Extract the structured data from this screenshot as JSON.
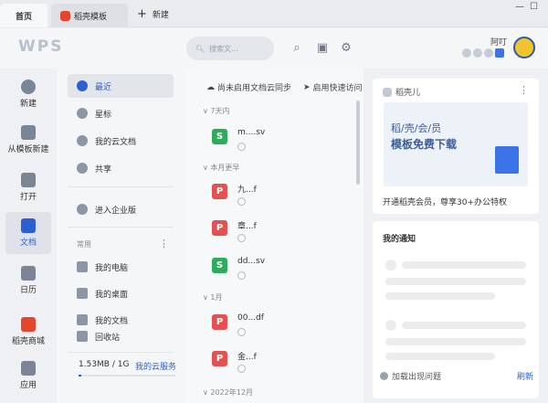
{
  "tabs": [
    {
      "label": "首页"
    },
    {
      "label": "稻壳模板"
    }
  ],
  "new_tab_label": "新建",
  "window_controls": {
    "minimize": "—",
    "maximize": "☐"
  },
  "header": {
    "logo": "WPS",
    "search_placeholder": "搜索文...",
    "username": "阿叮",
    "icons": [
      "headset-icon",
      "shirt-icon",
      "gear-icon"
    ]
  },
  "leftnav": [
    {
      "label": "新建",
      "icon": "plus-icon"
    },
    {
      "label": "从模板新建",
      "icon": "template-icon"
    },
    {
      "label": "打开",
      "icon": "folder-icon"
    },
    {
      "label": "文档",
      "icon": "document-icon",
      "active": true
    },
    {
      "label": "日历",
      "icon": "calendar-icon"
    },
    {
      "label": "稻壳商城",
      "icon": "store-icon"
    },
    {
      "label": "应用",
      "icon": "apps-icon"
    }
  ],
  "sidebar": {
    "items": [
      {
        "label": "最近",
        "active": true
      },
      {
        "label": "星标"
      },
      {
        "label": "我的云文档"
      },
      {
        "label": "共享"
      },
      {
        "label": "进入企业版"
      }
    ],
    "common_label": "常用",
    "common_items": [
      {
        "label": "我的电脑"
      },
      {
        "label": "我的桌面"
      },
      {
        "label": "我的文档"
      },
      {
        "label": "回收站"
      }
    ],
    "storage": "1.53MB / 1G",
    "storage_link": "我的云服务",
    "storage_fraction": 0.03
  },
  "filelist": {
    "sync_label": "尚未启用文档云同步",
    "quick_label": "启用快速访问",
    "groups": [
      {
        "title": "7天内",
        "files": [
          {
            "name": "m....sv",
            "type": "s"
          }
        ]
      },
      {
        "title": "本月更早",
        "files": [
          {
            "name": "九...f",
            "type": "p"
          },
          {
            "name": "章...f",
            "type": "p"
          },
          {
            "name": "dd...sv",
            "type": "s"
          }
        ]
      },
      {
        "title": "1月",
        "files": [
          {
            "name": "00...df",
            "type": "p"
          },
          {
            "name": "金...f",
            "type": "p"
          }
        ]
      },
      {
        "title": "2022年12月",
        "files": []
      }
    ]
  },
  "right": {
    "promo_title": "稻壳儿",
    "promo_line1": "稻/壳/会/员",
    "promo_line2": "模板免费下载",
    "promo_desc": "开通稻壳会员，尊享30+办公特权",
    "notice_title": "我的通知",
    "help_label": "加载出现问题",
    "refresh_label": "刷新"
  }
}
